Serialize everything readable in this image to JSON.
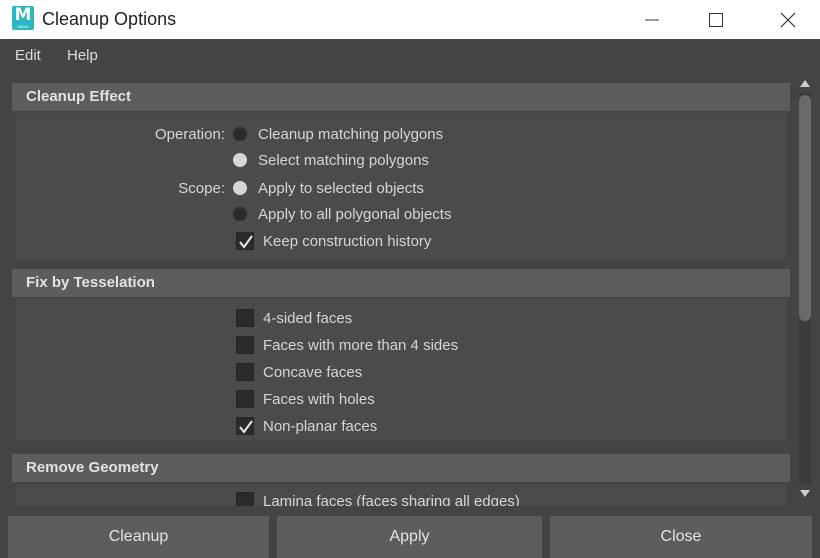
{
  "window": {
    "title": "Cleanup Options",
    "logo_letter": "M",
    "logo_sub": "MAYA",
    "controls": [
      "minimize-icon",
      "maximize-icon",
      "close-icon"
    ]
  },
  "menu": {
    "items": [
      "Edit",
      "Help"
    ]
  },
  "sections": {
    "cleanup_effect": {
      "title": "Cleanup Effect",
      "operation_label": "Operation:",
      "scope_label": "Scope:",
      "operation_options": [
        {
          "label": "Cleanup matching polygons",
          "selected": false
        },
        {
          "label": "Select matching polygons",
          "selected": true
        }
      ],
      "scope_options": [
        {
          "label": "Apply to selected objects",
          "selected": true
        },
        {
          "label": "Apply to all polygonal objects",
          "selected": false
        }
      ],
      "keep_history": {
        "label": "Keep construction history",
        "checked": true
      }
    },
    "fix_by_tesselation": {
      "title": "Fix by Tesselation",
      "options": [
        {
          "label": "4-sided faces",
          "checked": false
        },
        {
          "label": "Faces with more than 4 sides",
          "checked": false
        },
        {
          "label": "Concave faces",
          "checked": false
        },
        {
          "label": "Faces with holes",
          "checked": false
        },
        {
          "label": "Non-planar faces",
          "checked": true
        }
      ]
    },
    "remove_geometry": {
      "title": "Remove Geometry",
      "options": [
        {
          "label": "Lamina faces (faces sharing all edges)",
          "checked": false
        }
      ]
    }
  },
  "buttons": {
    "cleanup": "Cleanup",
    "apply": "Apply",
    "close": "Close"
  },
  "colors": {
    "background": "#444444",
    "panel": "#4b4b4b",
    "header": "#5d5d5d",
    "text": "#d6d6d6",
    "logo": "#2cb8c2"
  }
}
